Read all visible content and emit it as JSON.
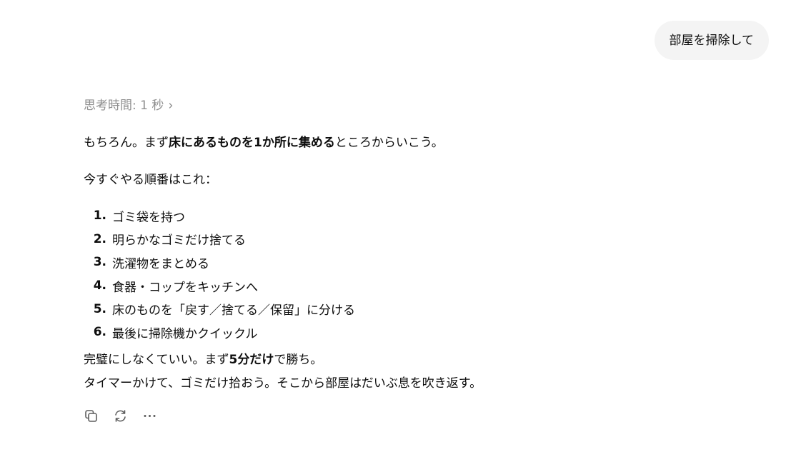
{
  "user_message": "部屋を掃除して",
  "assistant": {
    "thinking_label": "思考時間: 1 秒",
    "intro": {
      "pre": "もちろん。まず",
      "bold": "床にあるものを1か所に集める",
      "post": "ところからいこう。"
    },
    "order_heading": "今すぐやる順番はこれ：",
    "steps": [
      {
        "num": "1.",
        "text": "ゴミ袋を持つ"
      },
      {
        "num": "2.",
        "text": "明らかなゴミだけ捨てる"
      },
      {
        "num": "3.",
        "text": "洗濯物をまとめる"
      },
      {
        "num": "4.",
        "text": "食器・コップをキッチンへ"
      },
      {
        "num": "5.",
        "text": "床のものを「戻す／捨てる／保留」に分ける"
      },
      {
        "num": "6.",
        "text": "最後に掃除機かクイックル"
      }
    ],
    "closing": {
      "pre": "完璧にしなくていい。まず",
      "bold": "5分だけ",
      "post": "で勝ち。",
      "line2": "タイマーかけて、ゴミだけ拾おう。そこから部屋はだいぶ息を吹き返す。"
    }
  },
  "actions": [
    {
      "name": "copy-icon"
    },
    {
      "name": "regenerate-icon"
    },
    {
      "name": "more-icon"
    }
  ]
}
